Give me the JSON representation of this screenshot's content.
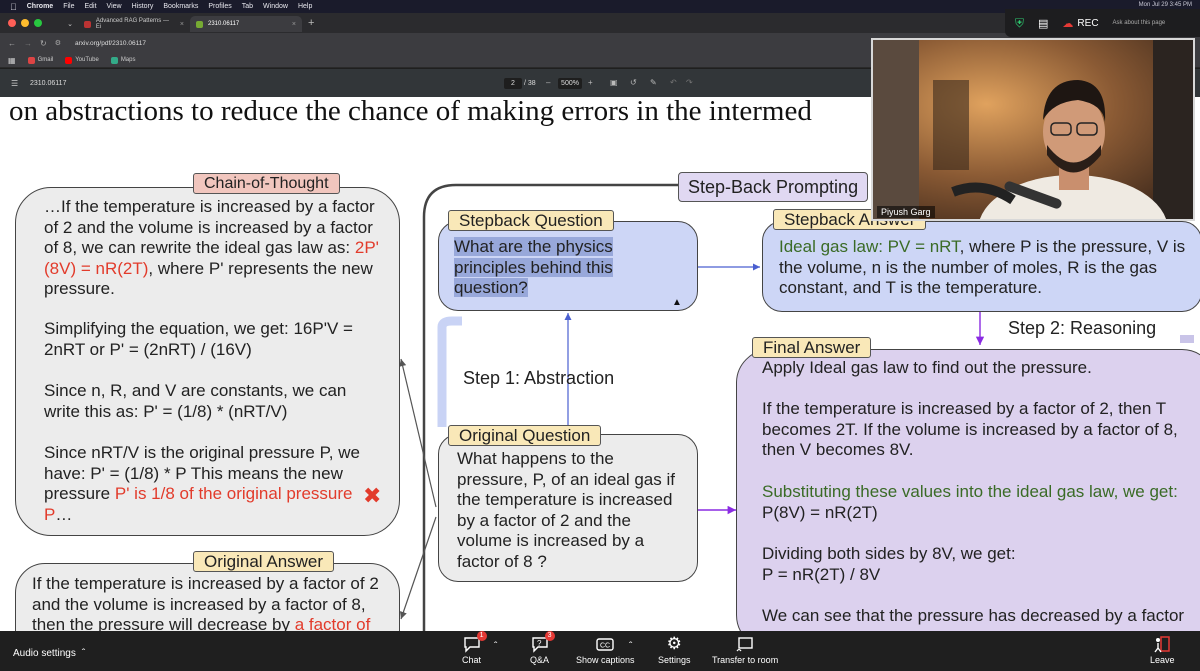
{
  "menubar": {
    "app": "Chrome",
    "items": [
      "File",
      "Edit",
      "View",
      "History",
      "Bookmarks",
      "Profiles",
      "Tab",
      "Window",
      "Help"
    ],
    "clock": "Mon Jul 29  3:45 PM"
  },
  "browser": {
    "tabs": [
      {
        "title": "Advanced RAG Patterns — Ei"
      },
      {
        "title": "2310.06117"
      }
    ],
    "url": "arxiv.org/pdf/2310.06117",
    "bookmarks": [
      "Gmail",
      "YouTube",
      "Maps"
    ]
  },
  "pdf_toolbar": {
    "file": "2310.06117",
    "page": "2",
    "total": "/ 38",
    "zoom": "500%"
  },
  "pdf": {
    "heading": "on abstractions to reduce the chance of making errors in the intermed",
    "cot": {
      "label": "Chain-of-Thought",
      "p1_a": "…If the temperature is increased by a factor of 2 and the volume is increased by a factor of 8, we can rewrite the ideal gas law as: ",
      "p1_red": "2P' (8V) = nR(2T)",
      "p1_b": ", where P' represents the new pressure.",
      "p2": "Simplifying the equation, we get: 16P'V = 2nRT or P' = (2nRT) / (16V)",
      "p3": "Since n, R, and V are constants, we can write this as: P' = (1/8) * (nRT/V)",
      "p4_a": "Since nRT/V is the original pressure P, we have: P' = (1/8) * P This means the new pressure ",
      "p4_red": "P' is 1/8 of the original pressure P",
      "p4_b": "…"
    },
    "orig_answer": {
      "label": "Original Answer",
      "text_a": "If the temperature is increased by a factor of 2 and the volume is increased by a factor of 8, then the pressure will decrease by ",
      "text_red": "a factor of"
    },
    "stepback_title": "Step-Back Prompting",
    "stepback_question": {
      "label": "Stepback Question",
      "text": "What are the physics principles behind this question?"
    },
    "stepback_answer": {
      "label": "Stepback Answer",
      "green": "Ideal gas law: PV = nRT",
      "text": ", where P is the pressure, V is the volume, n is the number of moles, R is the gas constant, and T is the temperature."
    },
    "step1": "Step 1: Abstraction",
    "step2": "Step 2: Reasoning",
    "original_question": {
      "label": "Original Question",
      "text": "What happens to the pressure, P, of an ideal gas if the temperature is increased by a factor of 2 and the volume is increased by a factor of 8 ?"
    },
    "final_answer": {
      "label": "Final Answer",
      "p1": "Apply Ideal gas law to find out the pressure.",
      "p2": "If the temperature is increased by a factor of 2, then T becomes 2T. If the volume is increased by a factor of 8, then V becomes 8V.",
      "p3_green": "Substituting these values into the ideal gas law, we get:",
      "p3b": "P(8V) = nR(2T)",
      "p4a": "Dividing both sides by 8V, we get:",
      "p4b": "P = nR(2T) / 8V",
      "p5": "We can see that the pressure has decreased by a factor"
    }
  },
  "meeting": {
    "rec": "REC",
    "ask": "Ask about this page",
    "participant": "Piyush Garg",
    "audio": "Audio settings",
    "controls": [
      {
        "label": "Chat",
        "badge": "1"
      },
      {
        "label": "Q&A",
        "badge": "3"
      },
      {
        "label": "Show captions"
      },
      {
        "label": "Settings"
      },
      {
        "label": "Transfer to room"
      }
    ],
    "leave": "Leave"
  },
  "colors": {
    "pdf_red": "#e23b2b",
    "pdf_green": "#3a6b26",
    "label_yellow": "#f9e8b8",
    "stepback_blue": "#cdd6f6",
    "final_purple": "#dcd1ee"
  }
}
